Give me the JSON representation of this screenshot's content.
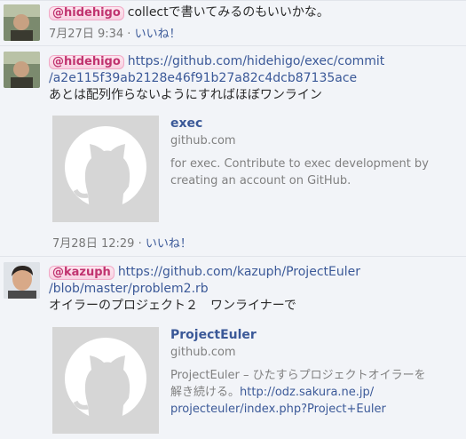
{
  "comments": [
    {
      "mention": "@hidehigo",
      "text": "collectで書いてみるのもいいかな。",
      "timestamp": "7月27日 9:34",
      "separator": "·",
      "like": "いいね！"
    },
    {
      "mention": "@hidehigo",
      "url_line1": "https://github.com/hidehigo/exec/commit",
      "url_line2": "/a2e115f39ab2128e46f91b27a82c4dcb87135ace",
      "text": "あとは配列作らないようにすればほぼワンライン",
      "attachment": {
        "title": "exec",
        "domain": "github.com",
        "desc_line1": "for exec. Contribute to exec development by",
        "desc_line2": "creating an account on GitHub."
      },
      "timestamp": "7月28日 12:29",
      "separator": "·",
      "like": "いいね！"
    },
    {
      "mention": "@kazuph",
      "url_line1": "https://github.com/kazuph/ProjectEuler",
      "url_line2": "/blob/master/problem2.rb",
      "text": "オイラーのプロジェクト２　ワンライナーで",
      "attachment": {
        "title": "ProjectEuler",
        "domain": "github.com",
        "desc_line1": "ProjectEuler – ひたすらプロジェクトオイラーを",
        "desc_line2_prefix": "解き続ける。",
        "desc_link_line1": "http://odz.sakura.ne.jp/",
        "desc_link_line2": "projecteuler/index.php?Project+Euler"
      }
    }
  ],
  "icons": {
    "github_thumbnail": "octocat-icon",
    "avatar": "user-avatar"
  },
  "colors": {
    "link": "#3b5998",
    "mention_text": "#c0336f",
    "muted": "#808080"
  }
}
